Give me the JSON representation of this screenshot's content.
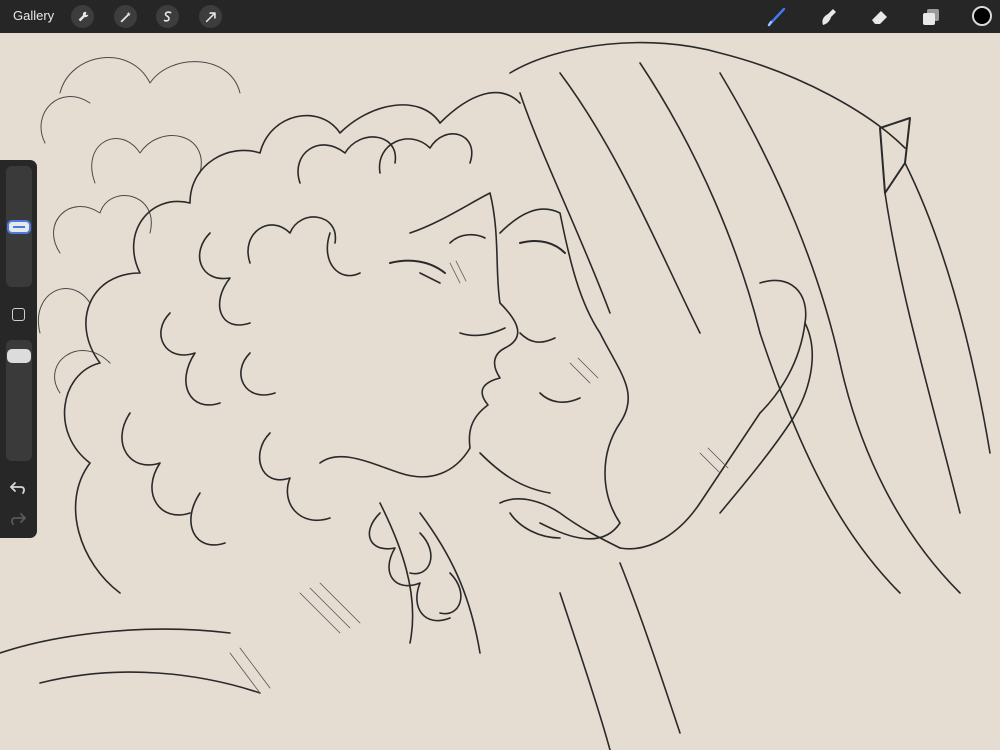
{
  "topbar": {
    "gallery_label": "Gallery",
    "left_tools": [
      {
        "icon": "wrench-icon"
      },
      {
        "icon": "magic-wand-icon"
      },
      {
        "icon": "selection-icon"
      },
      {
        "icon": "transform-arrow-icon"
      }
    ],
    "right_tools": [
      {
        "icon": "brush-icon",
        "active": true
      },
      {
        "icon": "smudge-icon"
      },
      {
        "icon": "eraser-icon"
      },
      {
        "icon": "layers-icon"
      }
    ],
    "current_color": "#000000"
  },
  "sidebar": {
    "brush_size_level": 0.5,
    "opacity_level": 0.93,
    "icons": [
      "modify-button",
      "undo-icon",
      "redo-icon"
    ]
  },
  "colors": {
    "toolbar_bg": "#262626",
    "canvas_bg": "#e6ddd2",
    "accent": "#4a7be3",
    "ink": "#2a2a2a"
  }
}
